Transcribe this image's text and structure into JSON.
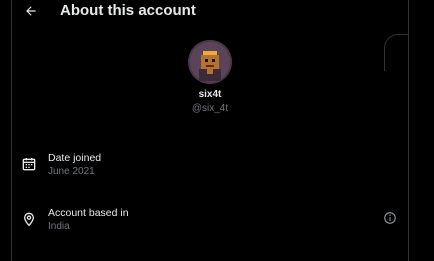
{
  "header": {
    "title": "About this account",
    "back_icon": "arrow-left-icon"
  },
  "profile": {
    "display_name": "six4t",
    "handle": "@six_4t",
    "avatar_colors": {
      "background": "#4a3848",
      "figure": "#b5722e",
      "hair": "#f2a83a"
    }
  },
  "details": [
    {
      "icon": "calendar-icon",
      "label": "Date joined",
      "value": "June 2021"
    },
    {
      "icon": "location-pin-icon",
      "label": "Account based in",
      "value": "India",
      "info_icon": "info-icon"
    }
  ],
  "colors": {
    "background": "#000000",
    "text_primary": "#e7e9ea",
    "text_secondary": "#71767b",
    "border": "#2f3336"
  }
}
